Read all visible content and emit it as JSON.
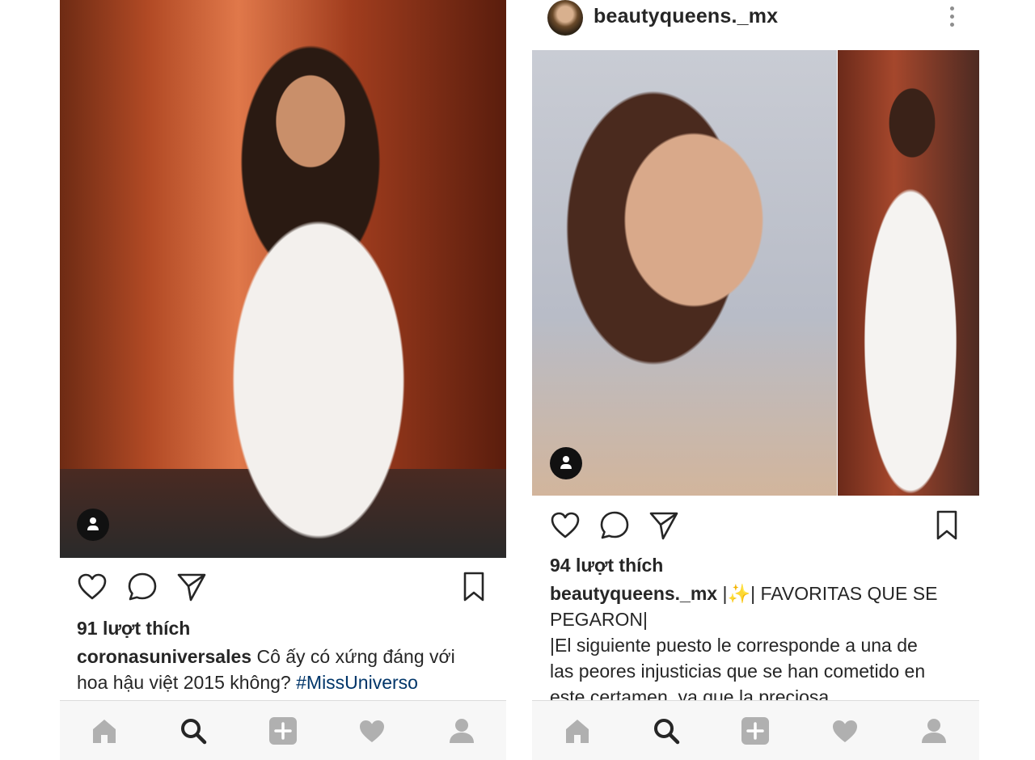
{
  "left_post": {
    "likes": "91 lượt thích",
    "caption_user": "coronasuniversales",
    "caption_text": " Cô ấy có xứng đáng với hoa hậu việt 2015 không? ",
    "hashtag": "#MissUniverso",
    "photo_icon": "person-tag-icon"
  },
  "right_post": {
    "header_user": "beautyqueens._mx",
    "likes": "94 lượt thích",
    "caption_user": "beautyqueens._mx",
    "caption_line1_rest": " |✨| FAVORITAS QUE SE",
    "caption_line2": "PEGARON|",
    "caption_line3": "|El siguiente puesto le corresponde a una de",
    "caption_line4": "las peores injusticias que se han cometido en",
    "caption_line5": "este certamen, ya que la preciosa",
    "photo_icon": "person-tag-icon"
  },
  "icons": {
    "like": "heart-icon",
    "comment": "comment-icon",
    "share": "send-icon",
    "save": "bookmark-icon",
    "more": "more-vertical-icon"
  },
  "nav": {
    "items": [
      "home-icon",
      "search-icon",
      "add-icon",
      "activity-icon",
      "profile-icon"
    ],
    "active": "search-icon"
  },
  "colors": {
    "text": "#262626",
    "hashtag": "#003569",
    "nav_bg": "#f7f7f7",
    "nav_inactive": "#b0b0b0",
    "nav_active": "#262626"
  }
}
